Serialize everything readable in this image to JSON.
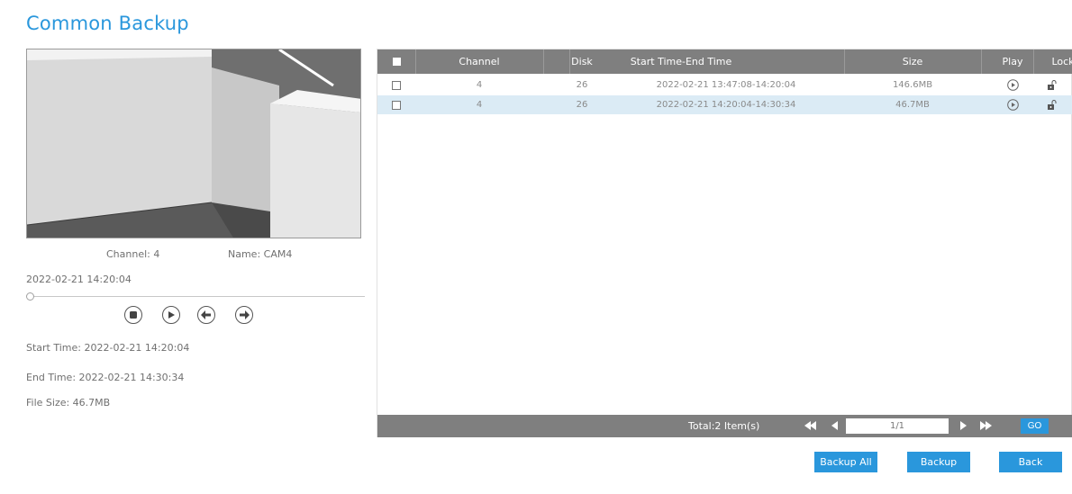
{
  "page": {
    "title": "Common Backup"
  },
  "preview": {
    "channel_text": "Channel: 4",
    "name_text": "Name: CAM4",
    "timestamp": "2022-02-21 14:20:04",
    "progress": 0.0,
    "start_time": "Start Time: 2022-02-21 14:20:04",
    "end_time": "End Time: 2022-02-21 14:30:34",
    "file_size": "File Size: 46.7MB",
    "controls": [
      "stop-icon",
      "play-icon",
      "previous-icon",
      "next-icon"
    ]
  },
  "table": {
    "headers": {
      "channel": "Channel",
      "disk": "Disk",
      "time": "Start Time-End Time",
      "size": "Size",
      "play": "Play",
      "lock": "Lock"
    },
    "rows": [
      {
        "channel": "4",
        "disk": "26",
        "time": "2022-02-21 13:47:08-14:20:04",
        "size": "146.6MB",
        "selected": false,
        "highlighted": false
      },
      {
        "channel": "4",
        "disk": "26",
        "time": "2022-02-21 14:20:04-14:30:34",
        "size": "46.7MB",
        "selected": false,
        "highlighted": true
      }
    ]
  },
  "pager": {
    "total": "Total:2 Item(s)",
    "page_value": "1/1",
    "go_label": "GO"
  },
  "actions": {
    "backup_all": "Backup All",
    "backup": "Backup",
    "back": "Back"
  },
  "colors": {
    "accent": "#2a97dc",
    "header_bg": "#7f7f7f",
    "row_highlight": "#dbebf5"
  }
}
